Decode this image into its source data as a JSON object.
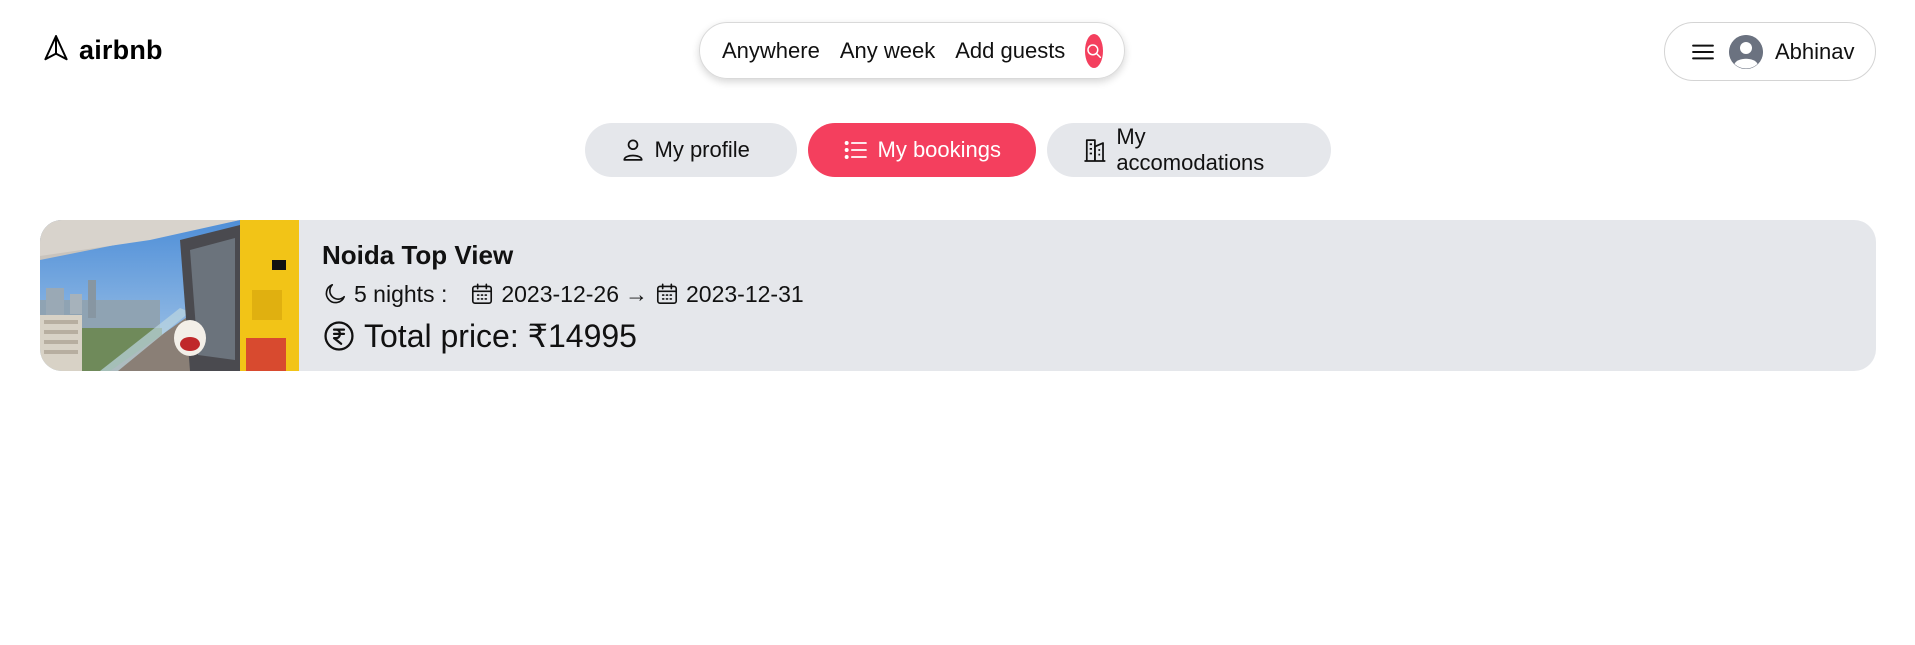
{
  "header": {
    "logo_text": "airbnb",
    "search": {
      "where": "Anywhere",
      "when": "Any week",
      "who": "Add guests"
    },
    "user": {
      "name": "Abhinav"
    }
  },
  "tabs": [
    {
      "label": "My profile",
      "icon": "user-icon",
      "active": false
    },
    {
      "label": "My bookings",
      "icon": "list-icon",
      "active": true
    },
    {
      "label": "My accomodations",
      "icon": "building-icon",
      "active": false
    }
  ],
  "bookings": [
    {
      "title": "Noida Top View",
      "nights": "5 nights :",
      "check_in": "2023-12-26",
      "arrow": "→",
      "check_out": "2023-12-31",
      "total_price": "Total price: ₹14995"
    }
  ],
  "colors": {
    "accent": "#f43f5e",
    "card_bg": "#e5e7eb"
  }
}
